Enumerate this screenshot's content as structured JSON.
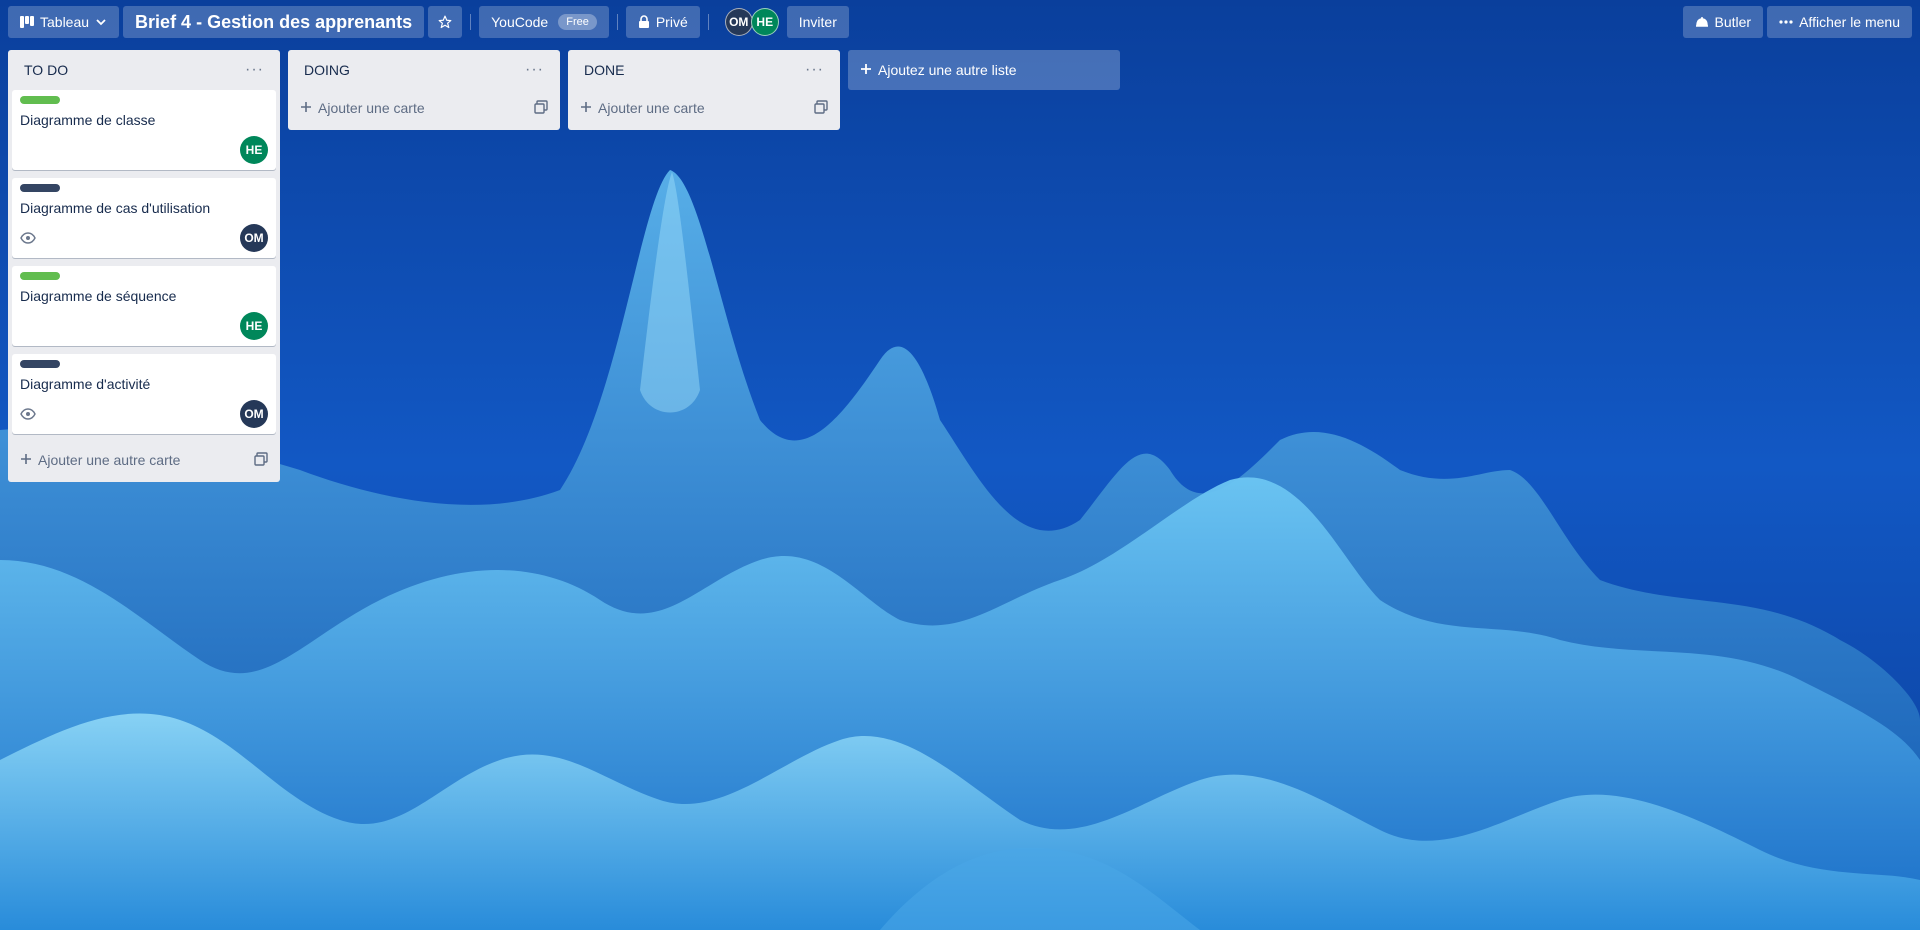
{
  "header": {
    "view_label": "Tableau",
    "board_title": "Brief 4 - Gestion des apprenants",
    "workspace": "YouCode",
    "workspace_badge": "Free",
    "visibility": "Privé",
    "members": [
      "OM",
      "HE"
    ],
    "invite_label": "Inviter",
    "butler_label": "Butler",
    "menu_label": "Afficher le menu"
  },
  "lists": [
    {
      "title": "TO DO",
      "cards": [
        {
          "title": "Diagramme de classe",
          "label_color": "#61bd4f",
          "member": "HE",
          "watching": false
        },
        {
          "title": "Diagramme de cas d'utilisation",
          "label_color": "#344563",
          "member": "OM",
          "watching": true
        },
        {
          "title": "Diagramme de séquence",
          "label_color": "#61bd4f",
          "member": "HE",
          "watching": false
        },
        {
          "title": "Diagramme d'activité",
          "label_color": "#344563",
          "member": "OM",
          "watching": true
        }
      ],
      "add_card_label": "Ajouter une autre carte"
    },
    {
      "title": "DOING",
      "cards": [],
      "add_card_label": "Ajouter une carte"
    },
    {
      "title": "DONE",
      "cards": [],
      "add_card_label": "Ajouter une carte"
    }
  ],
  "add_list_label": "Ajoutez une autre liste",
  "colors": {
    "label_green": "#61bd4f",
    "label_navy": "#344563",
    "avatar_green": "#00875a",
    "avatar_dark": "#253858",
    "list_bg": "#ebecf0"
  }
}
